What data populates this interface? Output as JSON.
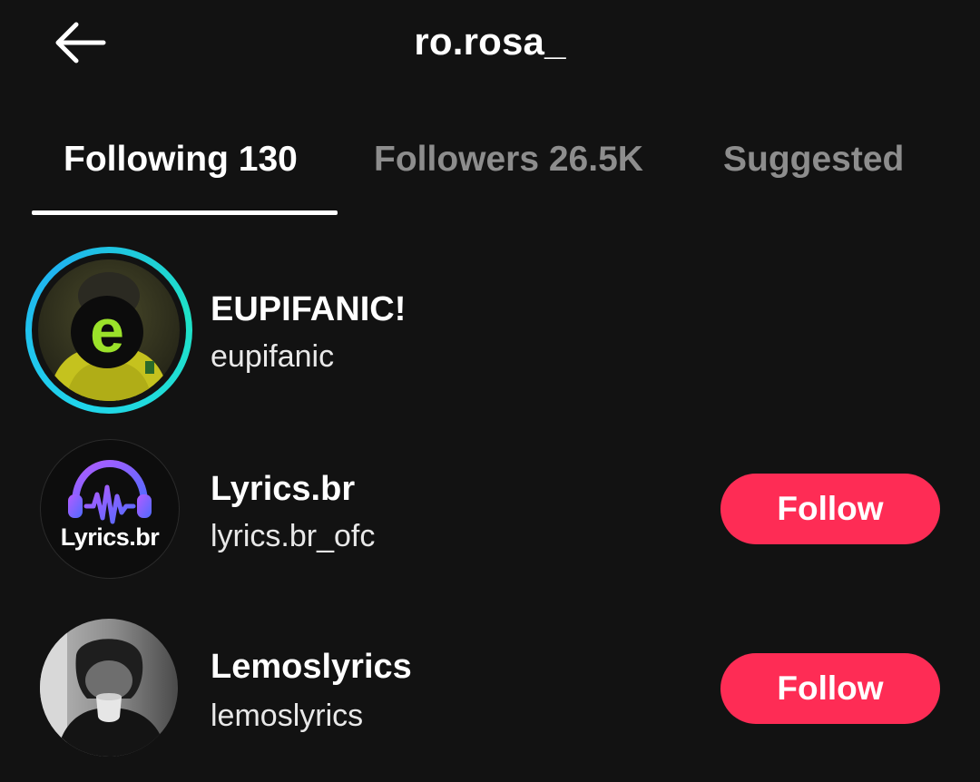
{
  "header": {
    "title": "ro.rosa_",
    "back_icon": "arrow-left-icon"
  },
  "tabs": [
    {
      "label": "Following 130",
      "active": true
    },
    {
      "label": "Followers 26.5K",
      "active": false
    },
    {
      "label": "Suggested",
      "active": false
    }
  ],
  "users": [
    {
      "name": "EUPIFANIC!",
      "handle": "eupifanic",
      "avatar_icon": "eupifanic-avatar",
      "has_story_ring": true,
      "follow_label": ""
    },
    {
      "name": "Lyrics.br",
      "handle": "lyrics.br_ofc",
      "avatar_icon": "lyrics-br-logo-avatar",
      "avatar_text": "Lyrics.br",
      "has_story_ring": false,
      "follow_label": "Follow"
    },
    {
      "name": "Lemoslyrics",
      "handle": "lemoslyrics",
      "avatar_icon": "lemoslyrics-photo-avatar",
      "has_story_ring": false,
      "follow_label": "Follow"
    }
  ],
  "colors": {
    "background": "#121212",
    "follow_button": "#fe2c55",
    "story_ring": "#20d5ec",
    "inactive_tab": "#8d8d8d"
  }
}
